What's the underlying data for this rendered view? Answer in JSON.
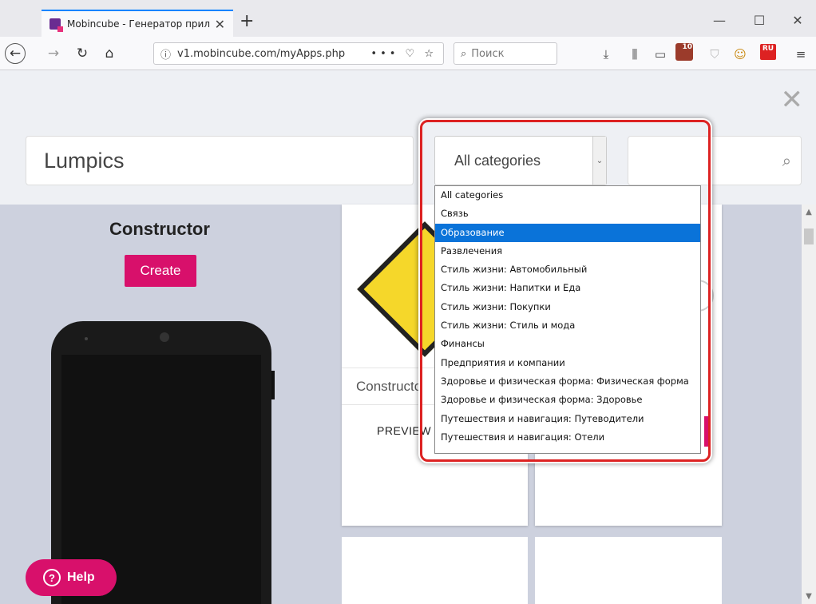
{
  "browser": {
    "tab_title": "Mobincube - Генератор прилож",
    "url": "v1.mobincube.com/myApps.php",
    "search_placeholder": "Поиск",
    "badge_count": "10",
    "badge_locale": "RU"
  },
  "page": {
    "app_name": "Lumpics",
    "category_selected": "All categories",
    "constructor_title": "Constructor",
    "create_label": "Create",
    "card_name": "Constructo",
    "card_preview": "PREVIEW",
    "help_label": "Help"
  },
  "dropdown": {
    "selected_index": 2,
    "options": [
      "All categories",
      "Связь",
      "Образование",
      "Развлечения",
      "Стиль жизни: Автомобильный",
      "Стиль жизни: Напитки и Еда",
      "Стиль жизни: Покупки",
      "Стиль жизни: Стиль и мода",
      "Финансы",
      "Предприятия и компании",
      "Здоровье и физическая форма: Физическая форма",
      "Здоровье и физическая форма: Здоровье",
      "Путешествия и навигация: Путеводители",
      "Путешествия и навигация: Отели"
    ]
  },
  "colors": {
    "accent_pink": "#d8106b",
    "selection_blue": "#0a73d9",
    "highlight_red": "#dd2222"
  }
}
